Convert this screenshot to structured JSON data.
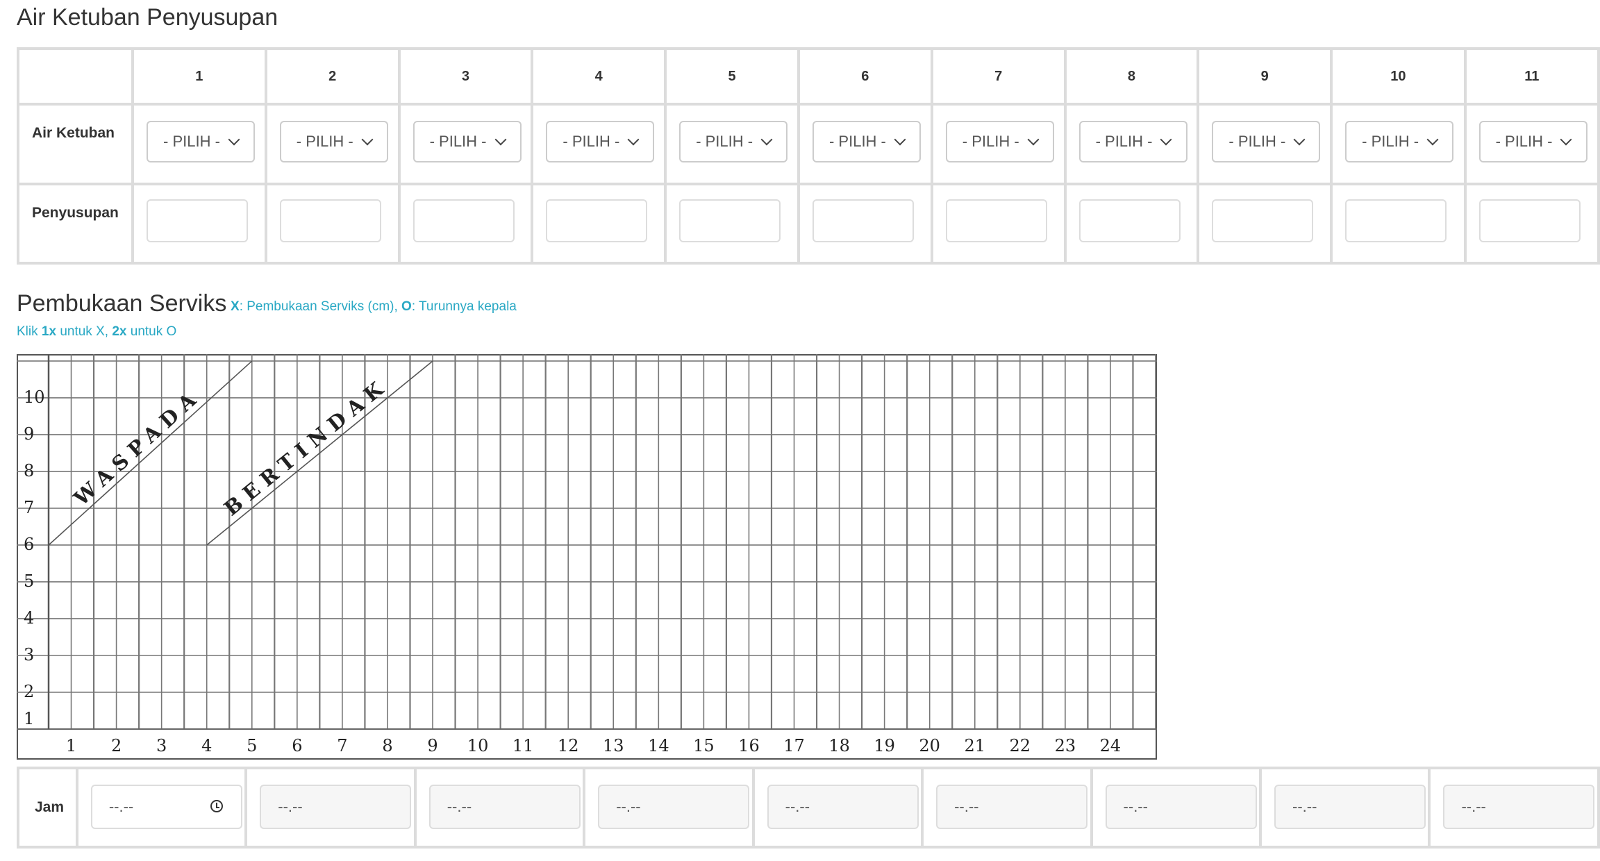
{
  "section1": {
    "title": "Air Ketuban Penyusupan",
    "columns": [
      "1",
      "2",
      "3",
      "4",
      "5",
      "6",
      "7",
      "8",
      "9",
      "10",
      "11"
    ],
    "row1_label": "Air Ketuban",
    "row2_label": "Penyusupan",
    "select_placeholder": "- PILIH -"
  },
  "section2": {
    "title": "Pembukaan Serviks",
    "legend": {
      "x_key": "X",
      "x_desc": ": Pembukaan Serviks (cm), ",
      "o_key": "O",
      "o_desc": ": Turunnya kepala"
    },
    "instruction": {
      "p1": "Klik ",
      "k1": "1x",
      "p2": " untuk X, ",
      "k2": "2x",
      "p3": " untuk O"
    }
  },
  "chart_data": {
    "type": "line",
    "y_ticks": [
      "1",
      "2",
      "3",
      "4",
      "5",
      "6",
      "7",
      "8",
      "9",
      "10"
    ],
    "x_ticks": [
      "1",
      "2",
      "3",
      "4",
      "5",
      "6",
      "7",
      "8",
      "9",
      "10",
      "11",
      "12",
      "13",
      "14",
      "15",
      "16",
      "17",
      "18",
      "19",
      "20",
      "21",
      "22",
      "23",
      "24"
    ],
    "ylim": [
      1,
      11
    ],
    "xlim": [
      0.5,
      24.5
    ],
    "series": [
      {
        "name": "WASPADA",
        "x": [
          0.5,
          5.0
        ],
        "y": [
          6,
          11
        ]
      },
      {
        "name": "BERTINDAK",
        "x": [
          4.0,
          9.0
        ],
        "y": [
          6,
          11
        ]
      }
    ],
    "grid": true
  },
  "jam": {
    "label": "Jam",
    "placeholder": "--.--",
    "count": 9
  }
}
